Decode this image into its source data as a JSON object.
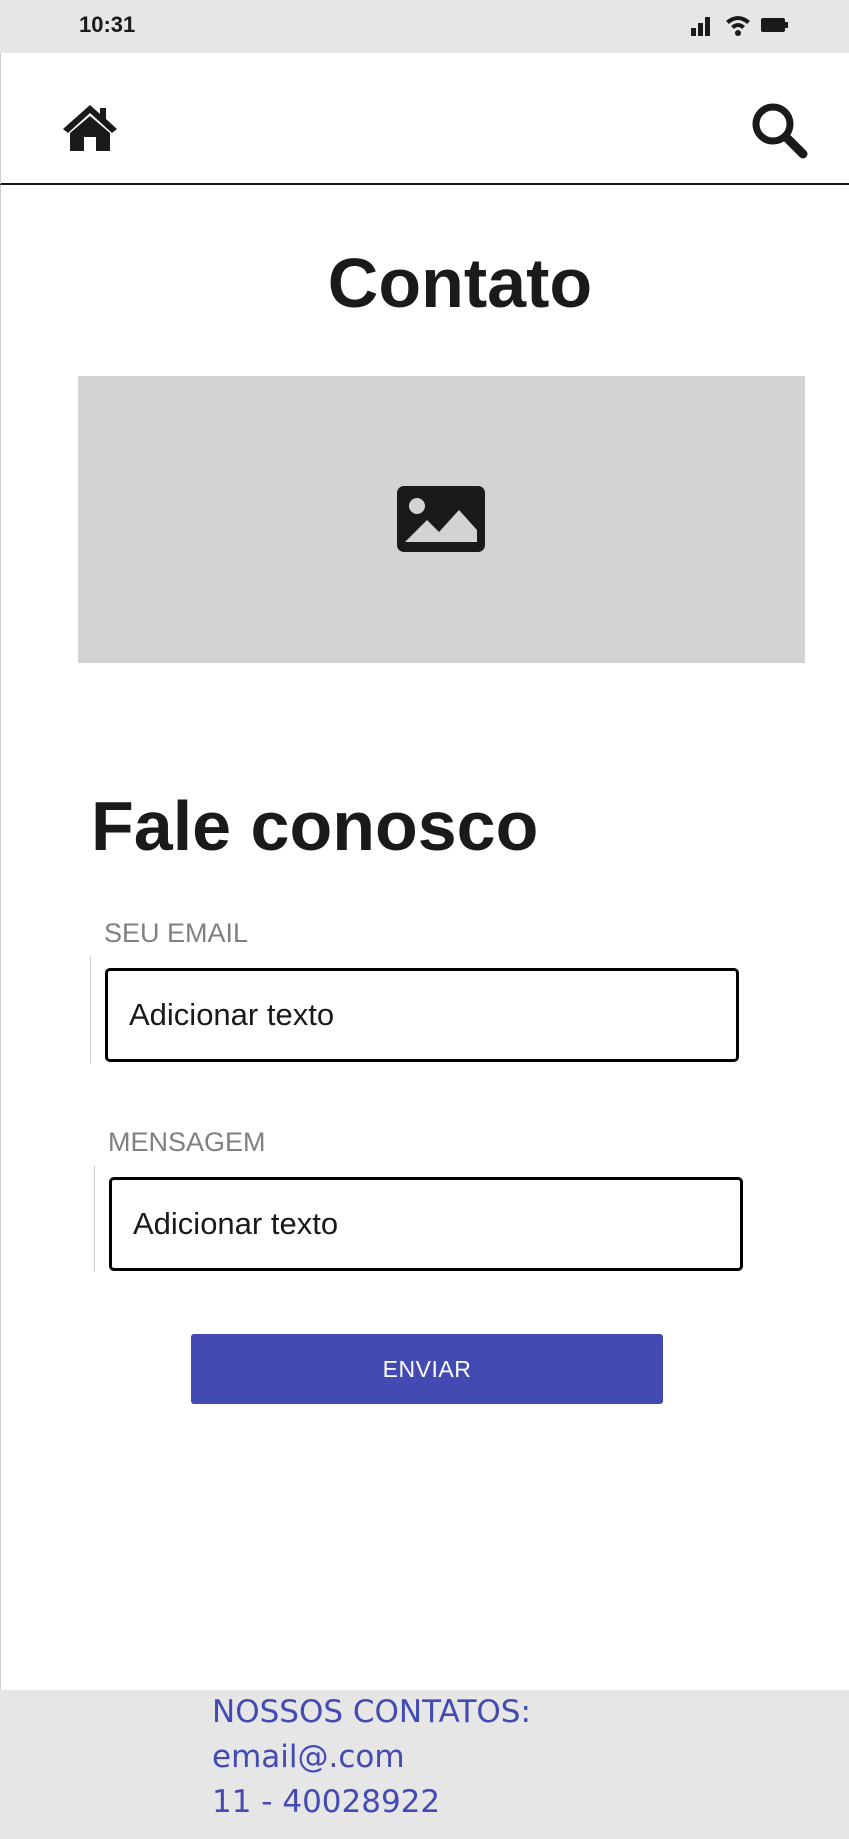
{
  "status_bar": {
    "time": "10:31",
    "icons": [
      "signal-icon",
      "wifi-icon",
      "battery-icon"
    ]
  },
  "nav": {
    "left_icon": "home-icon",
    "right_icon": "search-icon"
  },
  "page": {
    "title": "Contato",
    "hero_image_icon": "image-placeholder-icon"
  },
  "form": {
    "heading": "Fale conosco",
    "email_label": "SEU EMAIL",
    "email_value": "Adicionar texto",
    "message_label": "MENSAGEM",
    "message_value": "Adicionar texto",
    "submit_label": "ENVIAR"
  },
  "footer": {
    "heading": "NOSSOS CONTATOS:",
    "email": "email@.com",
    "phone": "11 - 40028922"
  },
  "colors": {
    "accent": "#434bb2",
    "status_bar_bg": "#e6e6e6",
    "footer_bg": "#e6e6e6",
    "image_placeholder_bg": "#d3d3d3",
    "label_gray": "#808080"
  }
}
